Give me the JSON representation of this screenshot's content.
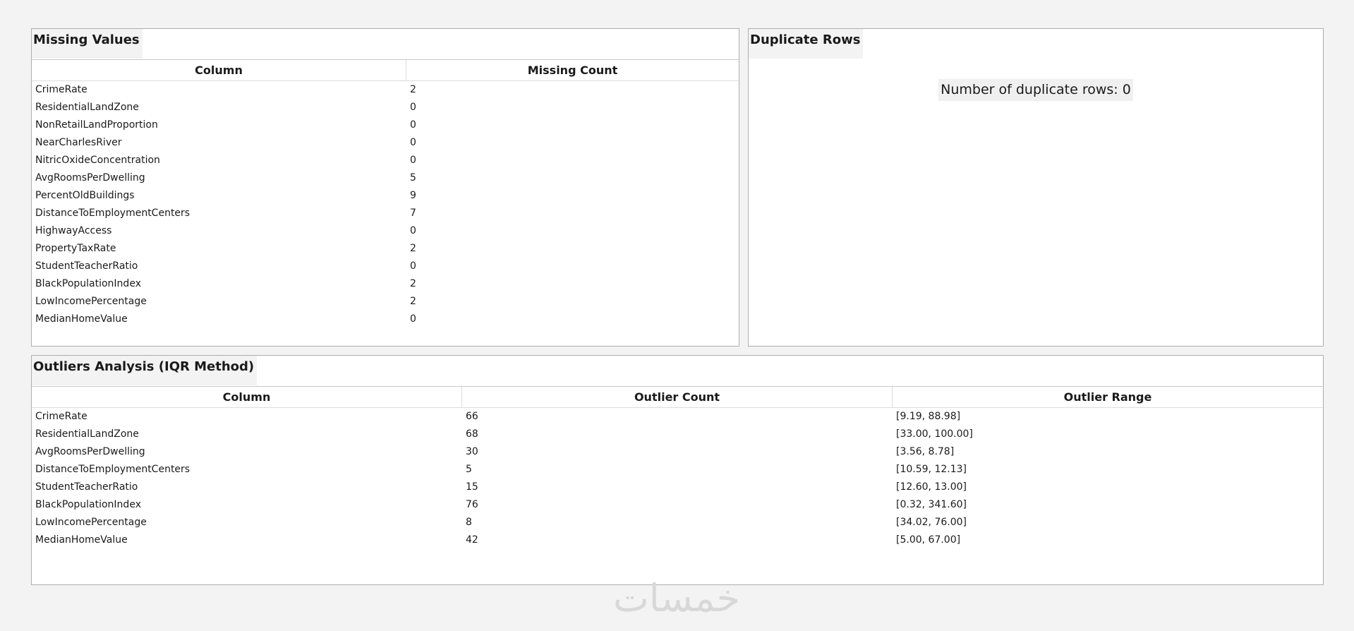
{
  "missing_values": {
    "title": "Missing Values",
    "headers": [
      "Column",
      "Missing Count"
    ],
    "rows": [
      [
        "CrimeRate",
        "2"
      ],
      [
        "ResidentialLandZone",
        "0"
      ],
      [
        "NonRetailLandProportion",
        "0"
      ],
      [
        "NearCharlesRiver",
        "0"
      ],
      [
        "NitricOxideConcentration",
        "0"
      ],
      [
        "AvgRoomsPerDwelling",
        "5"
      ],
      [
        "PercentOldBuildings",
        "9"
      ],
      [
        "DistanceToEmploymentCenters",
        "7"
      ],
      [
        "HighwayAccess",
        "0"
      ],
      [
        "PropertyTaxRate",
        "2"
      ],
      [
        "StudentTeacherRatio",
        "0"
      ],
      [
        "BlackPopulationIndex",
        "2"
      ],
      [
        "LowIncomePercentage",
        "2"
      ],
      [
        "MedianHomeValue",
        "0"
      ]
    ]
  },
  "duplicate_rows": {
    "title": "Duplicate Rows",
    "message": "Number of duplicate rows: 0"
  },
  "outliers": {
    "title": "Outliers Analysis (IQR Method)",
    "headers": [
      "Column",
      "Outlier Count",
      "Outlier Range"
    ],
    "rows": [
      [
        "CrimeRate",
        "66",
        "[9.19, 88.98]"
      ],
      [
        "ResidentialLandZone",
        "68",
        "[33.00, 100.00]"
      ],
      [
        "AvgRoomsPerDwelling",
        "30",
        "[3.56, 8.78]"
      ],
      [
        "DistanceToEmploymentCenters",
        "5",
        "[10.59, 12.13]"
      ],
      [
        "StudentTeacherRatio",
        "15",
        "[12.60, 13.00]"
      ],
      [
        "BlackPopulationIndex",
        "76",
        "[0.32, 341.60]"
      ],
      [
        "LowIncomePercentage",
        "8",
        "[34.02, 76.00]"
      ],
      [
        "MedianHomeValue",
        "42",
        "[5.00, 67.00]"
      ]
    ]
  },
  "watermark": "خمسات"
}
